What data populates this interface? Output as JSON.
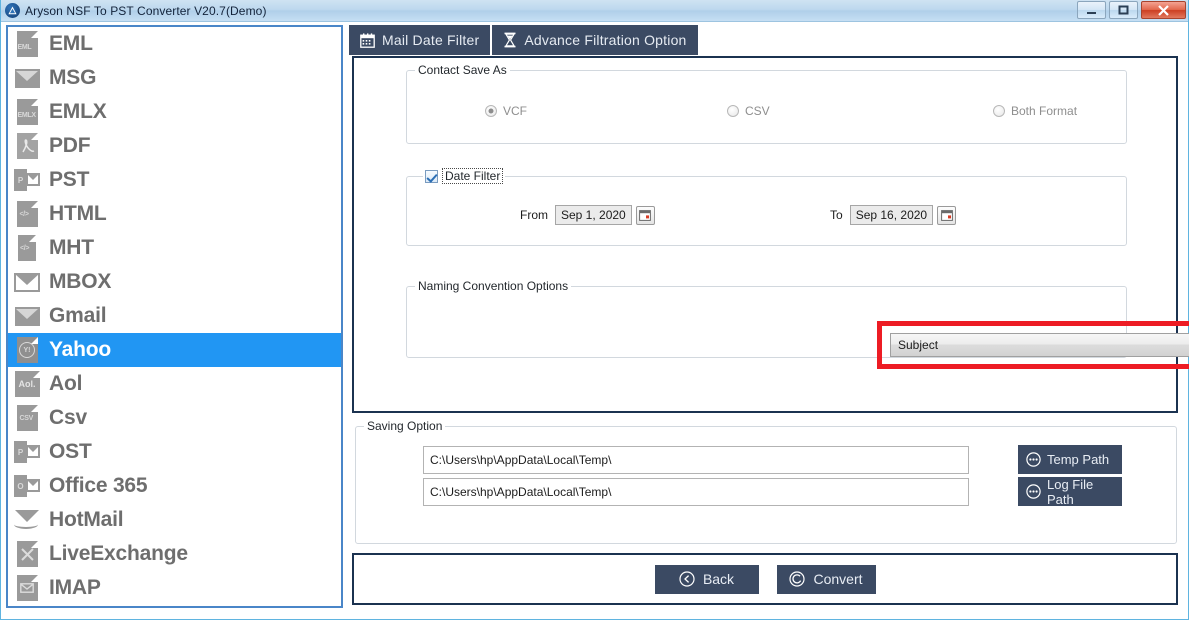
{
  "window": {
    "title": "Aryson NSF To PST Converter V20.7(Demo)",
    "app_icon": "app-logo-icon",
    "controls": {
      "minimize": "minimize-icon",
      "maximize": "maximize-icon",
      "close": "close-icon"
    },
    "accent": "#3b4a63",
    "selection_color": "#2196f3",
    "annotation_color": "#ed1c24"
  },
  "sidebar": {
    "items": [
      {
        "label": "EML",
        "icon": "eml-file-icon",
        "tag": "EML",
        "selected": false
      },
      {
        "label": "MSG",
        "icon": "msg-envelope-icon",
        "tag": "",
        "selected": false
      },
      {
        "label": "EMLX",
        "icon": "emlx-file-icon",
        "tag": "EMLX",
        "selected": false
      },
      {
        "label": "PDF",
        "icon": "pdf-file-icon",
        "tag": "",
        "selected": false
      },
      {
        "label": "PST",
        "icon": "pst-outlook-icon",
        "tag": "P",
        "selected": false
      },
      {
        "label": "HTML",
        "icon": "html-file-icon",
        "tag": "</>",
        "selected": false
      },
      {
        "label": "MHT",
        "icon": "mht-file-icon",
        "tag": "</>",
        "selected": false
      },
      {
        "label": "MBOX",
        "icon": "mbox-envelope-icon",
        "tag": "",
        "selected": false
      },
      {
        "label": "Gmail",
        "icon": "gmail-icon",
        "tag": "",
        "selected": false
      },
      {
        "label": "Yahoo",
        "icon": "yahoo-icon",
        "tag": "Y!",
        "selected": true
      },
      {
        "label": "Aol",
        "icon": "aol-icon",
        "tag": "Aol.",
        "selected": false
      },
      {
        "label": "Csv",
        "icon": "csv-file-icon",
        "tag": "CSV",
        "selected": false
      },
      {
        "label": "OST",
        "icon": "ost-outlook-icon",
        "tag": "P",
        "selected": false
      },
      {
        "label": "Office 365",
        "icon": "office365-icon",
        "tag": "O",
        "selected": false
      },
      {
        "label": "HotMail",
        "icon": "hotmail-icon",
        "tag": "",
        "selected": false
      },
      {
        "label": "LiveExchange",
        "icon": "live-exchange-icon",
        "tag": "",
        "selected": false
      },
      {
        "label": "IMAP",
        "icon": "imap-envelope-icon",
        "tag": "",
        "selected": false
      }
    ]
  },
  "tabs": [
    {
      "label": "Mail Date Filter",
      "icon": "calendar-icon",
      "active": false
    },
    {
      "label": "Advance Filtration Option",
      "icon": "hourglass-icon",
      "active": true
    }
  ],
  "contact_save_as": {
    "title": "Contact Save As",
    "options": [
      {
        "label": "VCF",
        "selected": true
      },
      {
        "label": "CSV",
        "selected": false
      },
      {
        "label": "Both Format",
        "selected": false
      }
    ]
  },
  "date_filter": {
    "title": "Date Filter",
    "checked": true,
    "from_label": "From",
    "from_value": "Sep 1, 2020",
    "to_label": "To",
    "to_value": "Sep 16, 2020",
    "calendar_icon": "calendar-picker-icon"
  },
  "naming_convention": {
    "title": "Naming Convention Options",
    "selected": "Subject",
    "dropdown_icon": "chevron-down-icon",
    "highlighted": true
  },
  "saving_option": {
    "title": "Saving Option",
    "temp_path_value": "C:\\Users\\hp\\AppData\\Local\\Temp\\",
    "log_path_value": "C:\\Users\\hp\\AppData\\Local\\Temp\\",
    "temp_path_button": "Temp Path",
    "log_path_button": "Log File Path",
    "browse_icon": "ellipsis-circle-icon"
  },
  "actions": {
    "back_label": "Back",
    "back_icon": "back-arrow-circle-icon",
    "convert_label": "Convert",
    "convert_icon": "convert-circle-icon"
  }
}
